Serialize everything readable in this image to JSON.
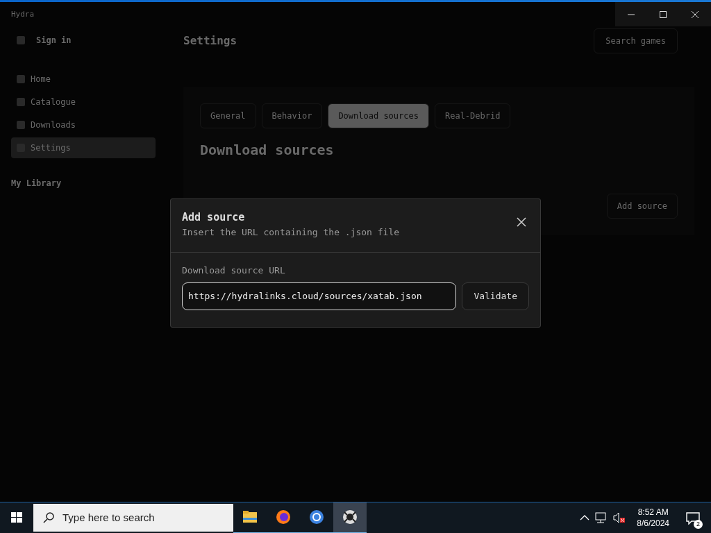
{
  "window": {
    "title": "Hydra"
  },
  "sidebar": {
    "sign_in": "Sign in",
    "items": [
      {
        "label": "Home",
        "selected": false
      },
      {
        "label": "Catalogue",
        "selected": false
      },
      {
        "label": "Downloads",
        "selected": false
      },
      {
        "label": "Settings",
        "selected": true
      }
    ],
    "library_heading": "My Library"
  },
  "header": {
    "title": "Settings",
    "search_placeholder": "Search games"
  },
  "tabs": [
    {
      "label": "General",
      "selected": false
    },
    {
      "label": "Behavior",
      "selected": false
    },
    {
      "label": "Download sources",
      "selected": true
    },
    {
      "label": "Real-Debrid",
      "selected": false
    }
  ],
  "section": {
    "title": "Download sources",
    "add_button": "Add source"
  },
  "dialog": {
    "title": "Add source",
    "subtitle": "Insert the URL containing the .json file",
    "field_label": "Download source URL",
    "field_value": "https://hydralinks.cloud/sources/xatab.json",
    "button": "Validate"
  },
  "taskbar": {
    "search_placeholder": "Type here to search",
    "apps": [
      {
        "kind": "folder",
        "selected": false
      },
      {
        "kind": "firefox",
        "selected": false
      },
      {
        "kind": "chrome",
        "selected": false
      },
      {
        "kind": "hydra",
        "selected": true
      }
    ],
    "time": "8:52 AM",
    "date": "8/6/2024",
    "notifications": "2"
  }
}
